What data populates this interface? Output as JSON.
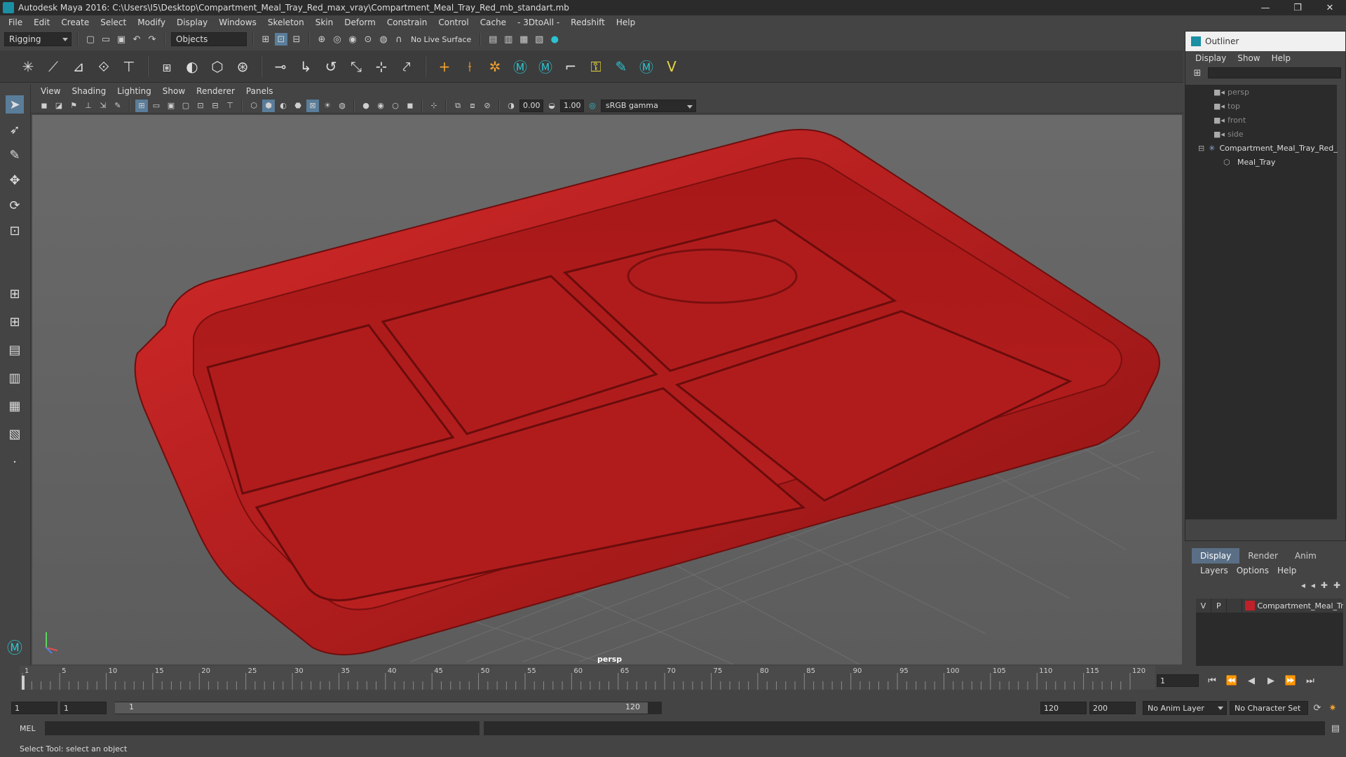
{
  "window": {
    "title": "Autodesk Maya 2016: C:\\Users\\I5\\Desktop\\Compartment_Meal_Tray_Red_max_vray\\Compartment_Meal_Tray_Red_mb_standart.mb",
    "minimize": "—",
    "restore": "❐",
    "close": "✕"
  },
  "menubar": [
    "File",
    "Edit",
    "Create",
    "Select",
    "Modify",
    "Display",
    "Windows",
    "Skeleton",
    "Skin",
    "Deform",
    "Constrain",
    "Control",
    "Cache",
    "- 3DtoAll -",
    "Redshift",
    "Help"
  ],
  "statusline": {
    "mode": "Rigging",
    "selection_mode": "Objects",
    "live_surface": "No Live Surface"
  },
  "viewport": {
    "menu": [
      "View",
      "Shading",
      "Lighting",
      "Show",
      "Renderer",
      "Panels"
    ],
    "exposure": "0.00",
    "gamma": "1.00",
    "color_space": "sRGB gamma",
    "camera_label": "persp"
  },
  "outliner": {
    "title": "Outliner",
    "menu": [
      "Display",
      "Show",
      "Help"
    ],
    "items": [
      {
        "label": "persp",
        "indent": 1,
        "icon": "camera-icon"
      },
      {
        "label": "top",
        "indent": 1,
        "icon": "camera-icon"
      },
      {
        "label": "front",
        "indent": 1,
        "icon": "camera-icon"
      },
      {
        "label": "side",
        "indent": 1,
        "icon": "camera-icon"
      },
      {
        "label": "Compartment_Meal_Tray_Red_",
        "indent": 0,
        "icon": "group-icon"
      },
      {
        "label": "Meal_Tray",
        "indent": 2,
        "icon": "mesh-icon"
      }
    ]
  },
  "layers": {
    "tabs": [
      "Display",
      "Render",
      "Anim"
    ],
    "active_tab": "Display",
    "menu": [
      "Layers",
      "Options",
      "Help"
    ],
    "rows": [
      {
        "v": "V",
        "p": "P",
        "name": "Compartment_Meal_Tr",
        "color": "#c0202a"
      }
    ]
  },
  "timeline": {
    "ticks": [
      "1",
      "5",
      "10",
      "15",
      "20",
      "25",
      "30",
      "35",
      "40",
      "45",
      "50",
      "55",
      "60",
      "65",
      "70",
      "75",
      "80",
      "85",
      "90",
      "95",
      "100",
      "105",
      "110",
      "115",
      "120"
    ],
    "current_frame": "1"
  },
  "range": {
    "start": "1",
    "playback_start": "1",
    "slider_start": "1",
    "slider_end": "120",
    "playback_end": "120",
    "end": "200",
    "anim_layer": "No Anim Layer",
    "character_set": "No Character Set"
  },
  "cmdline": {
    "label": "MEL"
  },
  "helpline": {
    "text": "Select Tool: select an object"
  },
  "colors": {
    "tray": "#b01a1a",
    "accent": "#1b8fa3"
  }
}
